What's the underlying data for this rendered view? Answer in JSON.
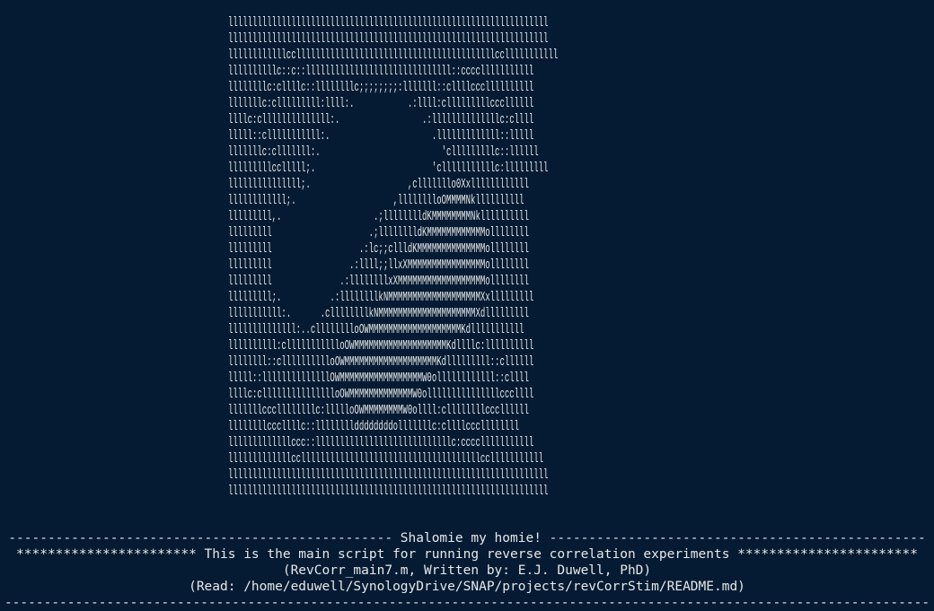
{
  "terminal": {
    "background": "#041b33",
    "foreground": "#e8e8e8",
    "ascii_logo": [
      "llllllllllllllllllllllllllllllllllllllllllllllllllllllllllllllllll",
      "llllllllllllllllllllllllllllllllllllllllllllllllllllllllllllllllll",
      "llllllllllllcclllllllllllllllllllllllllllllllllllllllllcclllllllllll",
      "llllllllllc::c::llllllllllllllllllllllllllllll::cccclllllllllll",
      "llllllllc:cllllc::llllllllc;;;;;;;;:lllllll::cllllcccllllllllll",
      "lllllllc:clllllllll:llll:.           .:llll:clllllllllcccllllll",
      "llllc:cllllllllllllll:.                 .:llllllllllllllc:cllll",
      "lllll::clllllllllll:.                     .lllllllllllll::lllll",
      "lllllllc:clllllll:.                         'clllllllllc::llllll",
      "lllllllllcclllll;.                        'clllllllllllc:lllllllll",
      "lllllllllllllll;.                    ,clllllllo0Xxllllllllllll",
      "llllllllllll;.                    ,lllllllloOMMMMNkllllllllll",
      "lllllllll,.                   .;lllllllldKMMMMMMMMNkllllllllll",
      "lllllllll                    .;lllllllldKMMMMMMMMMMMMollllllll",
      "lllllllll                  .:lc;;cllldKMMMMMMMMMMMMMMollllllll",
      "lllllllll                .:llll;;llxXMMMMMMMMMMMMMMMMollllllll",
      "lllllllll              .:llllllllxXMMMMMMMMMMMMMMMMMMollllllll",
      "lllllllll;.          .:llllllllkNMMMMMMMMMMMMMMMMMMMXxlllllllll",
      "lllllllllll:.      .cllllllllkNMMMMMMMMMMMMMMMMMMMMXdlllllllll",
      "llllllllllllll:..clllllllloOWMMMMMMMMMMMMMMMMMMMKdlllllllllll",
      "llllllllll:cllllllllllloOWMMMMMMMMMMMMMMMMMMMKdllllc:llllllllll",
      "llllllll::clllllllllloOWMMMMMMMMMMMMMMMMMMMKdlllllllll::cllllll",
      "lllll::llllllllllllllOWMMMMMMMMMMMMMMMMMW0ollllllllllll::cllll",
      "llllc:cllllllllllllllloOWMMMMMMMMMMMMMW0olllllllllllllllcccllll",
      "lllllllcccllllllllc:llllloOWMMMMMMMMW0ollll:cllllllllcccllllll",
      "llllllllcccllllc::llllllllddddddddolllllllc:cllllcccllllllll",
      "lllllllllllllccc::llllllllllllllllllllllllllllc:cccclllllllllll",
      "lllllllllllllcclllllllllllllllllllllllllllllllllllllcclllllllllll",
      "llllllllllllllllllllllllllllllllllllllllllllllllllllllllllllllllll",
      "llllllllllllllllllllllllllllllllllllllllllllllllllllllllllllllllll"
    ],
    "greeting_line": "------------------------------------------------- Shalomie my homie! ------------------------------------------------",
    "main_line": "*********************** This is the main script for running reverse correlation experiments ***********************",
    "credit_line": "(RevCorr_main7.m, Written by: E.J. Duwell, PhD)",
    "readme_line": "(Read: /home/eduwell/SynologyDrive/SNAP/projects/revCorrStim/README.md)",
    "bottom_rule": "----------------------------------------------------------------------------------------------------------------------"
  }
}
